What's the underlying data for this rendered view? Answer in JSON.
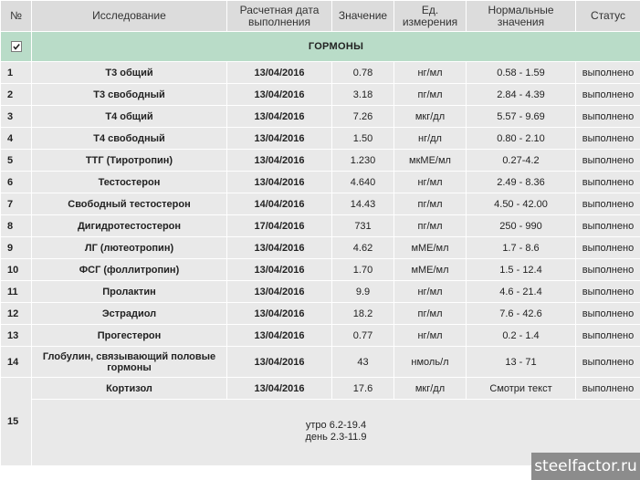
{
  "header": {
    "num": "№",
    "study": "Исследование",
    "date_l1": "Расчетная дата",
    "date_l2": "выполнения",
    "value": "Значение",
    "unit_l1": "Ед.",
    "unit_l2": "измерения",
    "norm_l1": "Нормальные",
    "norm_l2": "значения",
    "status": "Статус"
  },
  "section": {
    "title": "ГОРМОНЫ",
    "checked": true
  },
  "rows": [
    {
      "num": "1",
      "name": "Т3 общий",
      "date": "13/04/2016",
      "value": "0.78",
      "unit": "нг/мл",
      "norm": "0.58 - 1.59",
      "status": "выполнено"
    },
    {
      "num": "2",
      "name": "Т3 свободный",
      "date": "13/04/2016",
      "value": "3.18",
      "unit": "пг/мл",
      "norm": "2.84 - 4.39",
      "status": "выполнено"
    },
    {
      "num": "3",
      "name": "Т4 общий",
      "date": "13/04/2016",
      "value": "7.26",
      "unit": "мкг/дл",
      "norm": "5.57 - 9.69",
      "status": "выполнено"
    },
    {
      "num": "4",
      "name": "Т4 свободный",
      "date": "13/04/2016",
      "value": "1.50",
      "unit": "нг/дл",
      "norm": "0.80 - 2.10",
      "status": "выполнено"
    },
    {
      "num": "5",
      "name": "ТТГ (Тиротропин)",
      "date": "13/04/2016",
      "value": "1.230",
      "unit": "мкМЕ/мл",
      "norm": "0.27-4.2",
      "status": "выполнено"
    },
    {
      "num": "6",
      "name": "Тестостерон",
      "date": "13/04/2016",
      "value": "4.640",
      "unit": "нг/мл",
      "norm": "2.49 - 8.36",
      "status": "выполнено"
    },
    {
      "num": "7",
      "name": "Свободный тестостерон",
      "date": "14/04/2016",
      "value": "14.43",
      "unit": "пг/мл",
      "norm": "4.50 - 42.00",
      "status": "выполнено"
    },
    {
      "num": "8",
      "name": "Дигидротестостерон",
      "date": "17/04/2016",
      "value": "731",
      "unit": "пг/мл",
      "norm": "250 - 990",
      "status": "выполнено"
    },
    {
      "num": "9",
      "name": "ЛГ (лютеотропин)",
      "date": "13/04/2016",
      "value": "4.62",
      "unit": "мМЕ/мл",
      "norm": "1.7 - 8.6",
      "status": "выполнено"
    },
    {
      "num": "10",
      "name": "ФСГ (фоллитропин)",
      "date": "13/04/2016",
      "value": "1.70",
      "unit": "мМЕ/мл",
      "norm": "1.5 - 12.4",
      "status": "выполнено"
    },
    {
      "num": "11",
      "name": "Пролактин",
      "date": "13/04/2016",
      "value": "9.9",
      "unit": "нг/мл",
      "norm": "4.6 - 21.4",
      "status": "выполнено"
    },
    {
      "num": "12",
      "name": "Эстрадиол",
      "date": "13/04/2016",
      "value": "18.2",
      "unit": "пг/мл",
      "norm": "7.6 - 42.6",
      "status": "выполнено"
    },
    {
      "num": "13",
      "name": "Прогестерон",
      "date": "13/04/2016",
      "value": "0.77",
      "unit": "нг/мл",
      "norm": "0.2 - 1.4",
      "status": "выполнено"
    },
    {
      "num": "14",
      "name_l1": "Глобулин, связывающий половые",
      "name_l2": "гормоны",
      "date": "13/04/2016",
      "value": "43",
      "unit": "нмоль/л",
      "norm": "13 - 71",
      "status": "выполнено"
    },
    {
      "num": "15",
      "name": "Кортизол",
      "date": "13/04/2016",
      "value": "17.6",
      "unit": "мкг/дл",
      "norm": "Смотри текст",
      "status": "выполнено",
      "note_l1": "утро 6.2-19.4",
      "note_l2": "день 2.3-11.9"
    }
  ],
  "watermark": "steelfactor.ru"
}
